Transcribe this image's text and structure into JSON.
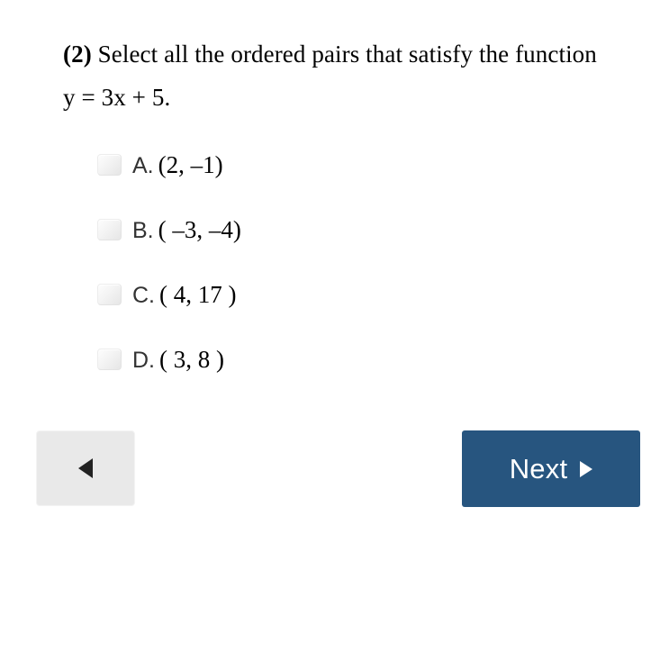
{
  "question": {
    "number_label": "(2)",
    "prompt": " Select all the ordered pairs that satisfy the function y = 3x + 5."
  },
  "options": [
    {
      "letter": "A.",
      "value": "(2, –1)"
    },
    {
      "letter": "B.",
      "value": "( –3, –4)"
    },
    {
      "letter": "C.",
      "value": "( 4, 17 )"
    },
    {
      "letter": "D.",
      "value": "( 3, 8 )"
    }
  ],
  "navigation": {
    "back_icon": "triangle-left-icon",
    "next_label": "Next",
    "next_icon": "triangle-right-icon"
  },
  "colors": {
    "next_button_background": "#27557f",
    "next_button_text": "#ffffff",
    "back_button_background": "#e9e9e9",
    "checkbox_background": "#f0f0f0",
    "page_background": "#ffffff",
    "text": "#000000"
  }
}
